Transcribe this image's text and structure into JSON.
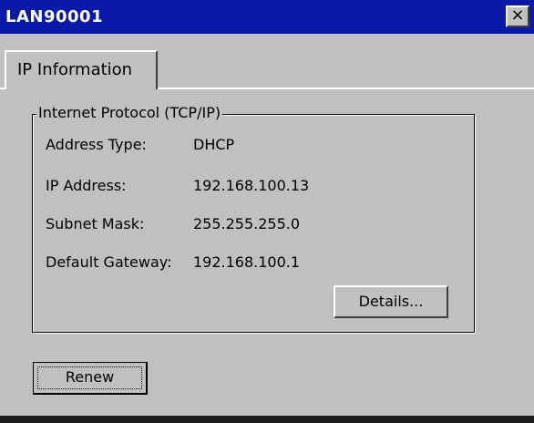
{
  "window": {
    "title": "LAN90001",
    "close_glyph": "×"
  },
  "tabs": [
    {
      "label": "IP Information",
      "selected": true
    }
  ],
  "group": {
    "title": "Internet Protocol (TCP/IP)",
    "rows": [
      {
        "label": "Address Type:",
        "value": "DHCP"
      },
      {
        "label": "IP Address:",
        "value": "192.168.100.13"
      },
      {
        "label": "Subnet Mask:",
        "value": "255.255.255.0"
      },
      {
        "label": "Default Gateway:",
        "value": "192.168.100.1"
      }
    ]
  },
  "buttons": {
    "details_label": "Details...",
    "renew_label": "Renew"
  },
  "colors": {
    "titlebar": "#0a1aa8",
    "face": "#c0c0c0"
  }
}
